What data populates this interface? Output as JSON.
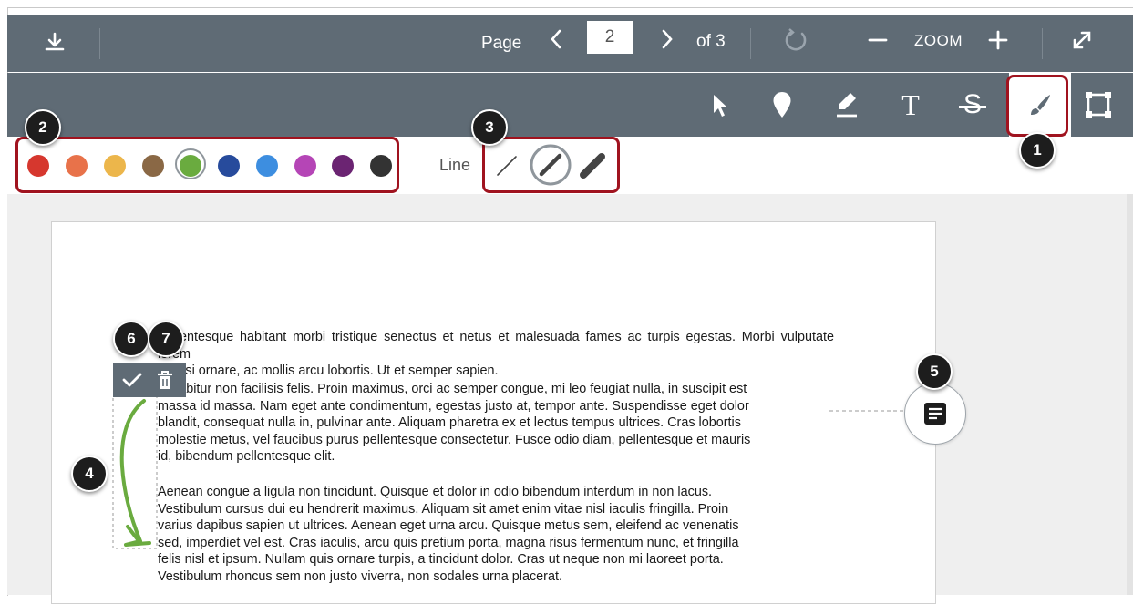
{
  "header": {
    "download_icon": "download-icon",
    "page_label": "Page",
    "page_value": "2",
    "of_label": "of 3",
    "zoom_label": "ZOOM",
    "prev_icon": "chevron-left-icon",
    "next_icon": "chevron-right-icon",
    "rotate_icon": "rotate-icon",
    "zoom_out_icon": "minus-icon",
    "zoom_in_icon": "plus-icon",
    "fullscreen_icon": "expand-icon"
  },
  "tools": [
    {
      "name": "select",
      "icon": "cursor-icon"
    },
    {
      "name": "point",
      "icon": "map-pin-icon"
    },
    {
      "name": "highlight",
      "icon": "highlighter-icon"
    },
    {
      "name": "text",
      "icon": "text-icon",
      "glyph": "T"
    },
    {
      "name": "strikeout",
      "icon": "strikethrough-icon",
      "glyph": "S"
    },
    {
      "name": "draw",
      "icon": "brush-icon",
      "active": true
    },
    {
      "name": "area",
      "icon": "area-box-icon"
    }
  ],
  "colors": [
    "#d6372e",
    "#e8724a",
    "#ecb64b",
    "#8a6845",
    "#6aab3f",
    "#274b9c",
    "#3d8ee0",
    "#b545b6",
    "#6b2472",
    "#333333"
  ],
  "selected_color_index": 4,
  "line": {
    "label": "Line",
    "widths": [
      "thin",
      "medium",
      "thick"
    ],
    "selected_index": 1
  },
  "callouts": {
    "c1": "1",
    "c2": "2",
    "c3": "3",
    "c4": "4",
    "c5": "5",
    "c6": "6",
    "c7": "7"
  },
  "annotation_toolbar": {
    "confirm_icon": "check-icon",
    "delete_icon": "trash-icon"
  },
  "comment_icon": "comment-icon",
  "document": {
    "paragraphs": [
      [
        "Pellentesque habitant morbi tristique senectus et netus et malesuada fames ac turpis egestas. Morbi vulputate lorem",
        "ac nisi ornare, ac mollis arcu lobortis. Ut et semper sapien."
      ],
      [
        "Curabitur non facilisis felis. Proin maximus, orci ac semper congue, mi leo feugiat nulla, in suscipit est",
        "massa id massa. Nam eget ante condimentum, egestas justo at, tempor ante. Suspendisse eget dolor",
        "blandit, consequat nulla in, pulvinar ante. Aliquam pharetra ex et lectus tempus ultrices. Cras lobortis",
        "molestie metus, vel faucibus purus pellentesque consectetur. Fusce odio diam, pellentesque et mauris",
        "id, bibendum pellentesque elit."
      ],
      [
        "Aenean congue a ligula non tincidunt. Quisque et dolor in odio bibendum interdum in non lacus.",
        "Vestibulum cursus dui eu hendrerit maximus. Aliquam sit amet enim vitae nisl iaculis fringilla. Proin",
        "varius dapibus sapien ut ultrices. Aenean eget urna arcu. Quisque metus sem, eleifend ac venenatis",
        "sed, imperdiet vel est. Cras iaculis, arcu quis pretium porta, magna risus fermentum nunc, et fringilla",
        "felis nisl et ipsum. Nullam quis ornare turpis, a tincidunt dolor. Cras ut neque non mi laoreet porta.",
        "Vestibulum rhoncus sem non justo viverra, non sodales urna placerat."
      ]
    ]
  }
}
